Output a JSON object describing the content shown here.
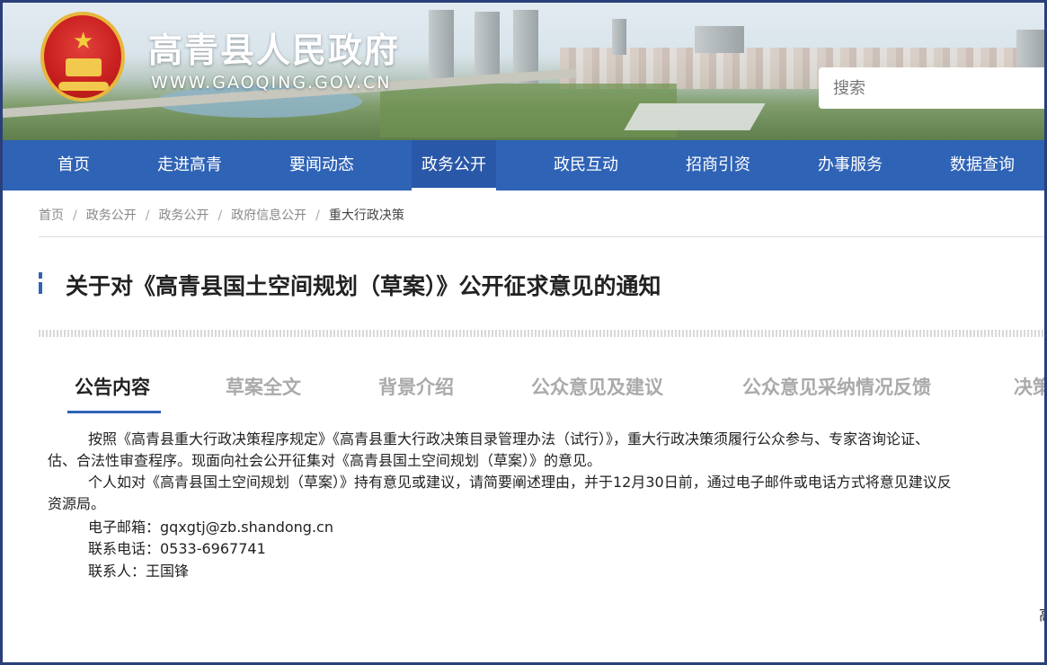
{
  "header": {
    "site_title": "高青县人民政府",
    "site_url": "WWW.GAOQING.GOV.CN",
    "search_placeholder": "搜索"
  },
  "nav": {
    "items": [
      "首页",
      "走进高青",
      "要闻动态",
      "政务公开",
      "政民互动",
      "招商引资",
      "办事服务",
      "数据查询"
    ],
    "active": "政务公开"
  },
  "breadcrumb": [
    "首页",
    "政务公开",
    "政务公开",
    "政府信息公开",
    "重大行政决策"
  ],
  "article": {
    "title": "关于对《高青县国土空间规划（草案）》公开征求意见的通知",
    "tabs": [
      "公告内容",
      "草案全文",
      "背景介绍",
      "公众意见及建议",
      "公众意见采纳情况反馈",
      "决策"
    ],
    "active_tab": "公告内容",
    "body": {
      "p1_line1": "按照《高青县重大行政决策程序规定》《高青县重大行政决策目录管理办法（试行）》，重大行政决策须履行公众参与、专家咨询论证、",
      "p1_line2": "估、合法性审查程序。现面向社会公开征集对《高青县国土空间规划（草案）》的意见。",
      "p2_line1": "个人如对《高青县国土空间规划（草案）》持有意见或建议，请简要阐述理由，并于12月30日前，通过电子邮件或电话方式将意见建议反",
      "p2_line2": "资源局。",
      "email": "电子邮箱：gqxgtj@zb.shandong.cn",
      "phone": "联系电话：0533-6967741",
      "contact": "联系人：王国锋",
      "trailing_char": "高"
    }
  },
  "colors": {
    "nav_bg": "#2f63b6",
    "accent": "#2f63b6",
    "frame": "#2a3f7a"
  }
}
